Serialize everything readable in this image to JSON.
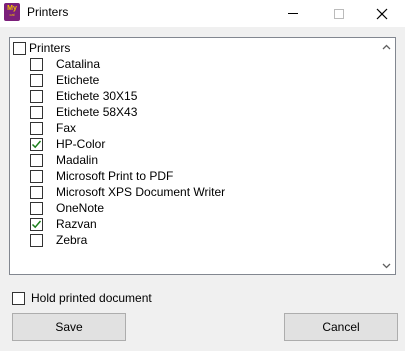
{
  "window": {
    "title": "Printers",
    "icon_name": "app-logo-icon",
    "icon_text_top": "My",
    "icon_text_bottom": "cal"
  },
  "tree": {
    "root": {
      "label": "Printers",
      "checked": false
    },
    "items": [
      {
        "label": "Catalina",
        "checked": false
      },
      {
        "label": "Etichete",
        "checked": false
      },
      {
        "label": "Etichete 30X15",
        "checked": false
      },
      {
        "label": "Etichete 58X43",
        "checked": false
      },
      {
        "label": "Fax",
        "checked": false
      },
      {
        "label": "HP-Color",
        "checked": true
      },
      {
        "label": "Madalin",
        "checked": false
      },
      {
        "label": "Microsoft Print to PDF",
        "checked": false
      },
      {
        "label": "Microsoft XPS Document Writer",
        "checked": false
      },
      {
        "label": "OneNote",
        "checked": false
      },
      {
        "label": "Razvan",
        "checked": true
      },
      {
        "label": "Zebra",
        "checked": false
      }
    ]
  },
  "options": {
    "hold_label": "Hold printed document",
    "hold_checked": false
  },
  "buttons": {
    "save_label": "Save",
    "cancel_label": "Cancel"
  },
  "colors": {
    "check_mark": "#1a7f1a",
    "icon_bg": "#7b1f7a",
    "icon_fg": "#f2c400"
  }
}
